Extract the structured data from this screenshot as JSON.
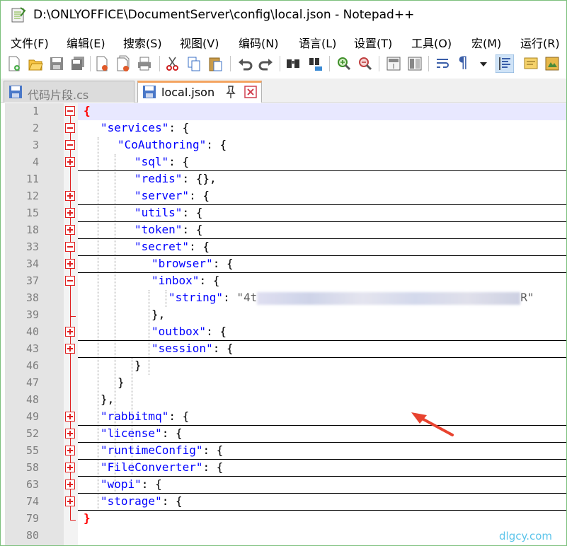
{
  "window": {
    "title": "D:\\ONLYOFFICE\\DocumentServer\\config\\local.json - Notepad++"
  },
  "menu": [
    {
      "label": "文件(F)"
    },
    {
      "label": "编辑(E)"
    },
    {
      "label": "搜索(S)"
    },
    {
      "label": "视图(V)"
    },
    {
      "label": "编码(N)"
    },
    {
      "label": "语言(L)"
    },
    {
      "label": "设置(T)"
    },
    {
      "label": "工具(O)"
    },
    {
      "label": "宏(M)"
    },
    {
      "label": "运行(R)"
    }
  ],
  "toolbar": {
    "icons": [
      "new-file-icon",
      "open-file-icon",
      "save-icon",
      "save-all-icon",
      "close-icon",
      "close-all-icon",
      "print-icon",
      "cut-icon",
      "copy-icon",
      "paste-icon",
      "undo-icon",
      "redo-icon",
      "find-icon",
      "replace-icon",
      "zoom-in-icon",
      "zoom-out-icon",
      "sync-vertical-icon",
      "sync-horizontal-icon",
      "word-wrap-icon",
      "show-all-chars-icon",
      "dropdown-icon",
      "indent-guide-icon",
      "user-defined-lang-icon",
      "doc-map-icon"
    ]
  },
  "tabs": [
    {
      "label": "代码片段.cs",
      "active": false
    },
    {
      "label": "local.json",
      "active": true
    }
  ],
  "editor": {
    "lines": [
      {
        "num": "1",
        "key": "",
        "rest": "{",
        "indent": 0
      },
      {
        "num": "2",
        "key": "\"services\"",
        "rest": ": {",
        "indent": 1
      },
      {
        "num": "3",
        "key": "\"CoAuthoring\"",
        "rest": ": {",
        "indent": 2
      },
      {
        "num": "4",
        "key": "\"sql\"",
        "rest": ": {",
        "indent": 3
      },
      {
        "num": "11",
        "key": "\"redis\"",
        "rest": ": {},",
        "indent": 3
      },
      {
        "num": "12",
        "key": "\"server\"",
        "rest": ": {",
        "indent": 3
      },
      {
        "num": "15",
        "key": "\"utils\"",
        "rest": ": {",
        "indent": 3
      },
      {
        "num": "18",
        "key": "\"token\"",
        "rest": ": {",
        "indent": 3
      },
      {
        "num": "33",
        "key": "\"secret\"",
        "rest": ": {",
        "indent": 3
      },
      {
        "num": "34",
        "key": "\"browser\"",
        "rest": ": {",
        "indent": 4
      },
      {
        "num": "37",
        "key": "\"inbox\"",
        "rest": ": {",
        "indent": 4
      },
      {
        "num": "38",
        "key": "\"string\"",
        "rest": ": ",
        "indent": 5,
        "value_start": "\"4t",
        "value_end": "R\""
      },
      {
        "num": "39",
        "key": "",
        "rest": "},",
        "indent": 4
      },
      {
        "num": "40",
        "key": "\"outbox\"",
        "rest": ": {",
        "indent": 4
      },
      {
        "num": "43",
        "key": "\"session\"",
        "rest": ": {",
        "indent": 4
      },
      {
        "num": "46",
        "key": "",
        "rest": "}",
        "indent": 3
      },
      {
        "num": "47",
        "key": "",
        "rest": "}",
        "indent": 2
      },
      {
        "num": "48",
        "key": "",
        "rest": "},",
        "indent": 1
      },
      {
        "num": "49",
        "key": "\"rabbitmq\"",
        "rest": ": {",
        "indent": 1
      },
      {
        "num": "52",
        "key": "\"license\"",
        "rest": ": {",
        "indent": 1
      },
      {
        "num": "55",
        "key": "\"runtimeConfig\"",
        "rest": ": {",
        "indent": 1
      },
      {
        "num": "58",
        "key": "\"FileConverter\"",
        "rest": ": {",
        "indent": 1
      },
      {
        "num": "63",
        "key": "\"wopi\"",
        "rest": ": {",
        "indent": 1
      },
      {
        "num": "74",
        "key": "\"storage\"",
        "rest": ": {",
        "indent": 1
      },
      {
        "num": "79",
        "key": "",
        "rest": "}",
        "indent": 0
      },
      {
        "num": "80",
        "key": "",
        "rest": "",
        "indent": 0
      }
    ]
  },
  "watermark": "dlgcy.com",
  "colors": {
    "key": "#0000ff",
    "brace": "#ff0000",
    "arrow": "#e8432f",
    "watermark": "#5cc4ea"
  }
}
